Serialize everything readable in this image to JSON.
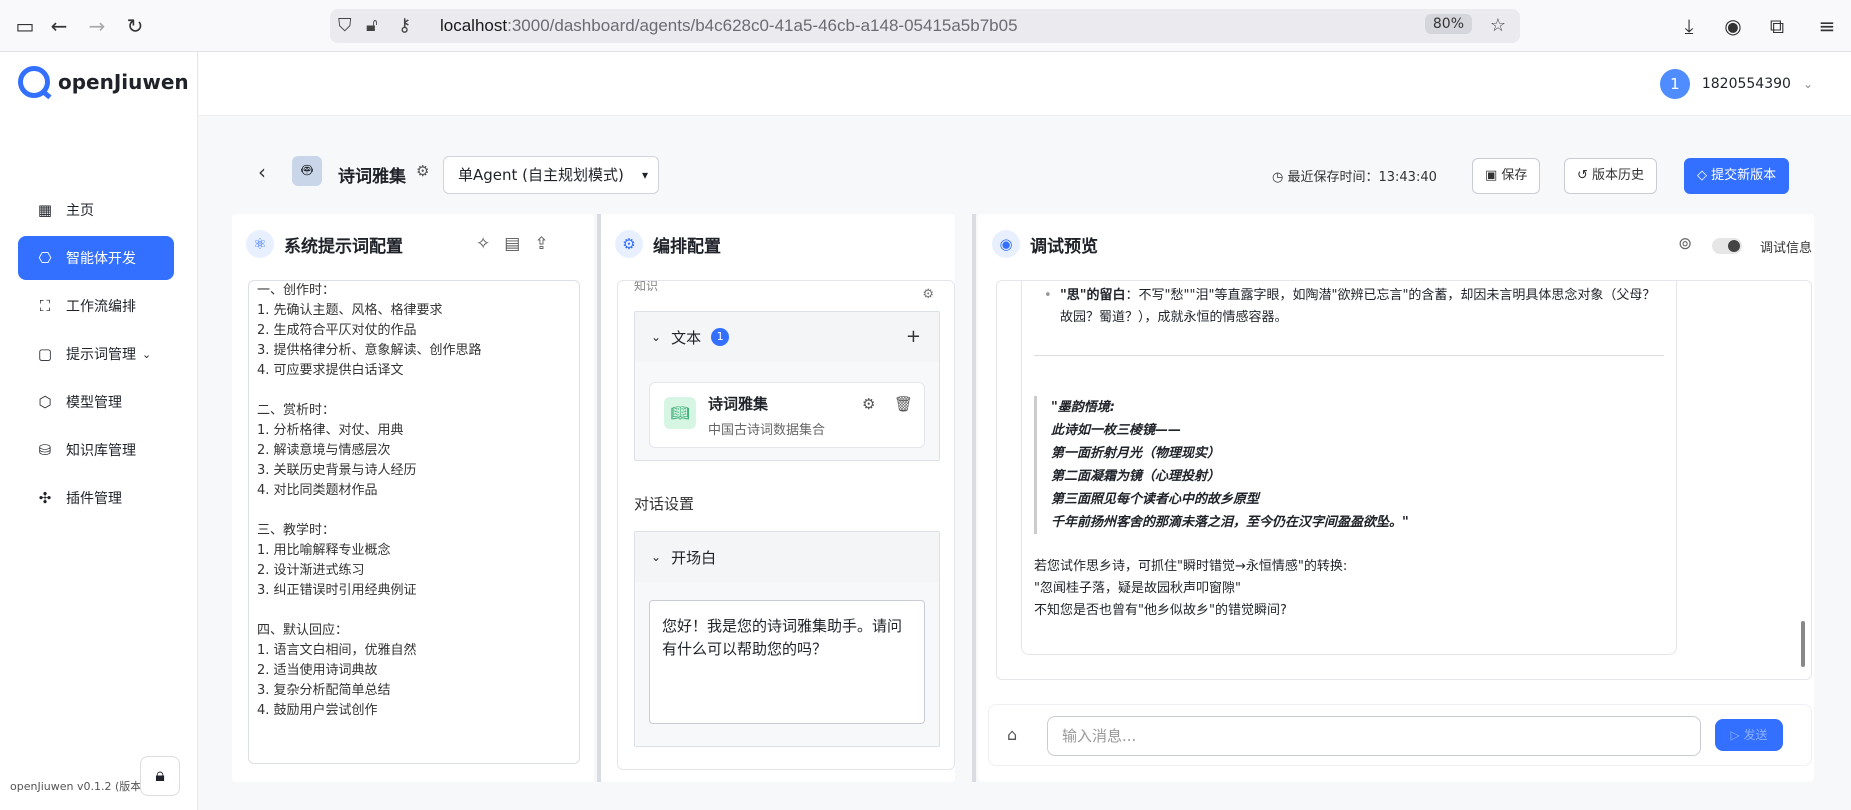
{
  "browser": {
    "url_host": "localhost",
    "url_path": ":3000/dashboard/agents/b4c628c0-41a5-46cb-a148-05415a5b7b05",
    "zoom": "80%"
  },
  "sidebar": {
    "logo_text": "openJiuwen",
    "items": [
      {
        "label": "主页",
        "icon": "home-icon"
      },
      {
        "label": "智能体开发",
        "icon": "robot-icon",
        "active": true
      },
      {
        "label": "工作流编排",
        "icon": "workflow-icon"
      },
      {
        "label": "提示词管理",
        "icon": "chat-icon",
        "has_dropdown": true
      },
      {
        "label": "模型管理",
        "icon": "model-icon"
      },
      {
        "label": "知识库管理",
        "icon": "database-icon"
      },
      {
        "label": "插件管理",
        "icon": "puzzle-icon"
      }
    ],
    "version": "openJiuwen v0.1.2 (版本"
  },
  "topbar": {
    "avatar_initial": "1",
    "username": "1820554390"
  },
  "header": {
    "agent_name": "诗词雅集",
    "mode": "单Agent (自主规划模式)",
    "last_saved": "最近保存时间：13:43:40",
    "save": "保存",
    "history": "版本历史",
    "submit": "提交新版本"
  },
  "prompt_panel": {
    "title": "系统提示词配置",
    "text": "一、创作时：\n1. 先确认主题、风格、格律要求\n2. 生成符合平仄对仗的作品\n3. 提供格律分析、意象解读、创作思路\n4. 可应要求提供白话译文\n\n二、赏析时：\n1. 分析格律、对仗、用典\n2. 解读意境与情感层次\n3. 关联历史背景与诗人经历\n4. 对比同类题材作品\n\n三、教学时：\n1. 用比喻解释专业概念\n2. 设计渐进式练习\n3. 纠正错误时引用经典例证\n\n四、默认回应：\n1. 语言文白相间，优雅自然\n2. 适当使用诗词典故\n3. 复杂分析配简单总结\n4. 鼓励用户尝试创作"
  },
  "config_panel": {
    "title": "编排配置",
    "kb_header_cut": "知识",
    "text_section": "文本",
    "text_count": "1",
    "kb_item_title": "诗词雅集",
    "kb_item_desc": "中国古诗词数据集合",
    "dialog_settings": "对话设置",
    "opening_section": "开场白",
    "opening_text": "您好！我是您的诗词雅集助手。请问有什么可以帮助您的吗？"
  },
  "debug_panel": {
    "title": "调试预览",
    "debug_info": "调试信息",
    "bullet_bold": "\"思\"的留白",
    "bullet_text": "：不写\"愁\"\"泪\"等直露字眼，如陶潜\"欲辨已忘言\"的含蓄，却因未言明具体思念对象（父母？故园？蜀道？），成就永恒的情感容器。",
    "quote_lines": [
      "\"墨韵悟境:",
      "此诗如一枚三棱镜——",
      "第一面折射月光（物理现实）",
      "第二面凝霜为镜（心理投射）",
      "第三面照见每个读者心中的故乡原型",
      "千年前扬州客舍的那滴未落之泪，至今仍在汉字间盈盈欲坠。\""
    ],
    "tail_lines": [
      "若您试作思乡诗，可抓住\"瞬时错觉→永恒情感\"的转换:",
      "\"忽闻桂子落，疑是故园秋声叩窗隙\"",
      "不知您是否也曾有\"他乡似故乡\"的错觉瞬间?"
    ],
    "input_placeholder": "输入消息...",
    "send": "发送"
  }
}
